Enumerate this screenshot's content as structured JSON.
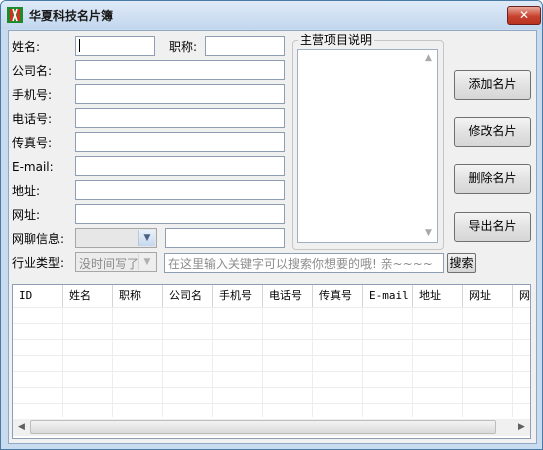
{
  "window": {
    "title": "华夏科技名片簿",
    "close_label": "✕"
  },
  "form": {
    "name_label": "姓名:",
    "title_label": "职称:",
    "company_label": "公司名:",
    "mobile_label": "手机号:",
    "phone_label": "电话号:",
    "fax_label": "传真号:",
    "email_label": "E-mail:",
    "address_label": "地址:",
    "website_label": "网址:",
    "im_label": "网聊信息:",
    "industry_label": "行业类型:",
    "industry_value": "没时间写了",
    "name_value": "",
    "title_value": "",
    "company_value": "",
    "mobile_value": "",
    "phone_value": "",
    "fax_value": "",
    "email_value": "",
    "address_value": "",
    "website_value": "",
    "im_value": ""
  },
  "business_group": {
    "title": "主营项目说明",
    "value": ""
  },
  "search": {
    "placeholder": "在这里输入关键字可以搜索你想要的哦! 亲~~~~",
    "button_label": "搜索"
  },
  "actions": {
    "add": "添加名片",
    "edit": "修改名片",
    "delete": "删除名片",
    "export": "导出名片"
  },
  "table": {
    "columns": [
      "ID",
      "姓名",
      "职称",
      "公司名",
      "手机号",
      "电话号",
      "传真号",
      "E-mail",
      "地址",
      "网址",
      "网"
    ]
  },
  "colors": {
    "title_bg": "#c9dcef",
    "close": "#c7432e",
    "client_bg": "#f0f0f0"
  }
}
